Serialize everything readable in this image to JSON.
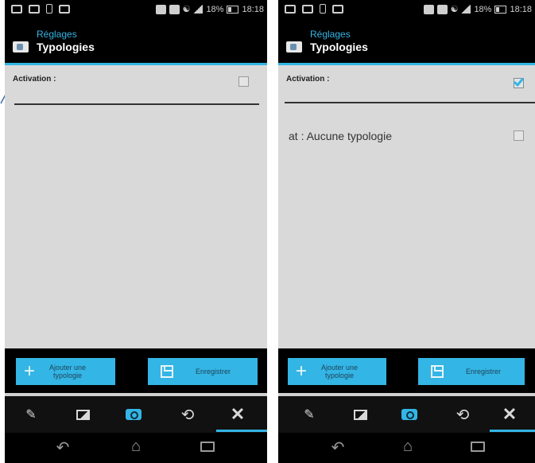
{
  "screens": [
    {
      "status": {
        "battery_pct": "18%",
        "time": "18:18"
      },
      "actionbar": {
        "subtitle": "Réglages",
        "title": "Typologies"
      },
      "activation": {
        "label": "Activation :",
        "checked": false
      },
      "typologies": [],
      "buttons": {
        "add_label": "Ajouter une typologie",
        "save_label": "Enregistrer"
      },
      "tabs": [
        "pencil-icon",
        "image-icon",
        "camera-icon",
        "history-icon",
        "tools-icon"
      ],
      "active_tab": "tools-icon"
    },
    {
      "status": {
        "battery_pct": "18%",
        "time": "18:18"
      },
      "actionbar": {
        "subtitle": "Réglages",
        "title": "Typologies"
      },
      "activation": {
        "label": "Activation :",
        "checked": true
      },
      "typologies": [
        {
          "label": "at : Aucune typologie",
          "checked": false
        }
      ],
      "buttons": {
        "add_label": "Ajouter une typologie",
        "save_label": "Enregistrer"
      },
      "tabs": [
        "pencil-icon",
        "image-icon",
        "camera-icon",
        "history-icon",
        "tools-icon"
      ],
      "active_tab": "tools-icon"
    }
  ],
  "colors": {
    "accent": "#33b5e5",
    "background": "#d9d9d9",
    "bars": "#000000"
  }
}
